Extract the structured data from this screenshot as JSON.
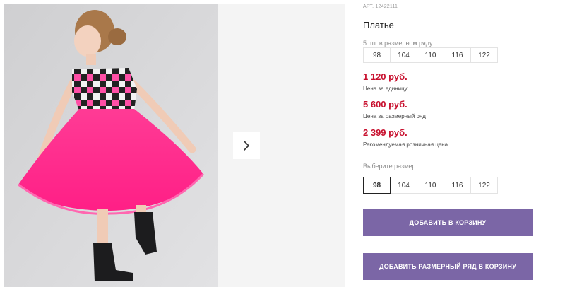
{
  "product": {
    "article": "АРТ. 12422111",
    "title": "Платье",
    "set_label": "5 шт. в размерном ряду",
    "set_sizes": [
      "98",
      "104",
      "110",
      "116",
      "122"
    ]
  },
  "prices": {
    "unit_price": "1 120 руб.",
    "unit_note": "Цена за единицу",
    "set_price": "5 600 руб.",
    "set_note": "Цена за размерный ряд",
    "retail_price": "2 399 руб.",
    "retail_note": "Рекомендуемая розничная цена"
  },
  "size_picker": {
    "label": "Выберите размер:",
    "options": [
      "98",
      "104",
      "110",
      "116",
      "122"
    ],
    "selected": "98"
  },
  "buttons": {
    "add_to_cart": "ДОБАВИТЬ В КОРЗИНУ",
    "add_set_to_cart": "ДОБАВИТЬ РАЗМЕРНЫЙ РЯД В КОРЗИНУ"
  },
  "gallery": {
    "next_icon": "chevron-right-icon"
  },
  "colors": {
    "price": "#c8102e",
    "button": "#7b66a6",
    "dress_skirt": "#ff2e8f"
  }
}
